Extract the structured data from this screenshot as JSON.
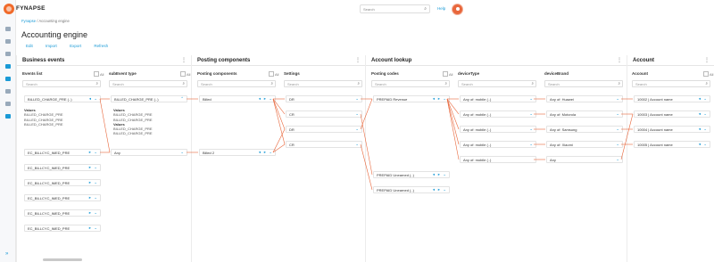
{
  "app": {
    "brand": "FYNAPSE",
    "search_placeholder": "Search",
    "help": "Help"
  },
  "breadcrumb": {
    "first": "Fynapse",
    "sep": " / ",
    "current": "Accounting engine"
  },
  "page_title": "Accounting engine",
  "actions": [
    "Edit",
    "Import",
    "Export",
    "Refresh"
  ],
  "panels": {
    "business": {
      "title": "Business events",
      "col1": "Events list",
      "col2": "subEvent type",
      "all": "All",
      "search": "Search",
      "events": [
        "BILLED_CHARGE_PRE (..)",
        "EC_BILLCYC_IMED_PRE",
        "EC_BILLCYC_IMED_PRE",
        "EC_BILLCYC_IMED_PRE",
        "EC_BILLCYC_IMED_PRE",
        "EC_BILLCYC_IMED_PRE",
        "EC_BILLCYC_IMED_PRE"
      ],
      "subevents": [
        "BILLED_CHARGE_PRE (..)",
        "Any"
      ],
      "values_label": "Values",
      "values_a": [
        "BILLED_CHARGE_PRE",
        "BILLED_CHARGE_PRE",
        "BILLED_CHARGE_PRE"
      ],
      "values_b": [
        "BILLED_CHARGE_PRE",
        "BILLED_CHARGE_PRE"
      ]
    },
    "posting": {
      "title": "Posting components",
      "col1": "Posting components",
      "col2": "Settings",
      "all": "All",
      "search": "Search",
      "components": [
        "Billed",
        "Billed 2"
      ],
      "settings": [
        "DR",
        "CR",
        "DR",
        "CR"
      ]
    },
    "lookup": {
      "title": "Account lookup",
      "col1": "Posting codes",
      "col2": "deviceType",
      "col3": "deviceBrand",
      "all": "All",
      "search": "Search",
      "codes": [
        "PREPAID Revenue",
        "PREPAID Unearned (..)",
        "PREPAID Unearned (..)"
      ],
      "types": [
        "Any of: mobile (..)",
        "Any of: mobile (..)",
        "Any of: mobile (..)",
        "Any of: mobile (..)",
        "Any of: mobile (..)"
      ],
      "brands": [
        "Any of: Huawei",
        "Any of: Motorola",
        "Any of: Samsung",
        "Any of: Xiaomi",
        "Any"
      ]
    },
    "account": {
      "title": "Account",
      "col1": "Account",
      "all": "All",
      "search": "Search",
      "accounts": [
        "10002 | Account name",
        "10003 | Account name",
        "10004 | Account name",
        "10005 | Account name"
      ]
    }
  },
  "colors": {
    "accent": "#1a9ad6",
    "brand": "#f06a2a",
    "connector": "#e8673c"
  }
}
